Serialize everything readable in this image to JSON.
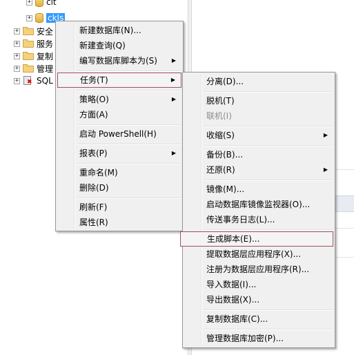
{
  "tree": {
    "partial_top_label": "cit",
    "selected_db_label": "ckJs",
    "folders": [
      {
        "label": "安全"
      },
      {
        "label": "服务"
      },
      {
        "label": "复制"
      },
      {
        "label": "管理"
      }
    ],
    "sql_agent_label": "SQL"
  },
  "context_menu": {
    "new_database": "新建数据库(N)...",
    "new_query": "新建查询(Q)",
    "script_database_as": "编写数据库脚本为(S)",
    "tasks": "任务(T)",
    "policies": "策略(O)",
    "facets": "方面(A)",
    "start_powershell": "启动 PowerShell(H)",
    "reports": "报表(P)",
    "rename": "重命名(M)",
    "delete": "删除(D)",
    "refresh": "刷新(F)",
    "properties": "属性(R)"
  },
  "tasks_submenu": {
    "detach": "分离(D)...",
    "take_offline": "脱机(T)",
    "bring_online": "联机(I)",
    "shrink": "收缩(S)",
    "back_up": "备份(B)...",
    "restore": "还原(R)",
    "mirror": "镜像(M)...",
    "launch_mirror_monitor": "启动数据库镜像监视器(O)...",
    "ship_transaction_logs": "传送事务日志(L)...",
    "generate_scripts": "生成脚本(E)...",
    "extract_data_tier_app": "提取数据层应用程序(X)...",
    "register_data_tier_app": "注册为数据层应用程序(R)...",
    "import_data": "导入数据(I)...",
    "export_data": "导出数据(X)...",
    "copy_database": "复制数据库(C)...",
    "manage_db_encryption": "管理数据库加密(P)..."
  },
  "colors": {
    "selection": "#3399ff",
    "highlight_border": "#a0505a",
    "menu_bg": "#f0f0f0"
  }
}
